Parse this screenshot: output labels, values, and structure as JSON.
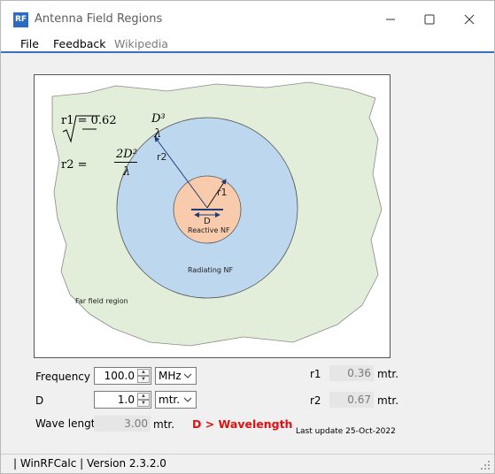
{
  "window": {
    "icon_text": "RF",
    "title": "Antenna Field Regions"
  },
  "menu": {
    "file": "File",
    "feedback": "Feedback",
    "wikipedia": "Wikipedia"
  },
  "figure": {
    "formula_r1_lhs": "r1 = 0.62",
    "formula_r1_num": "D³",
    "formula_r1_den": "λ",
    "formula_r2_lhs": "r2 =",
    "formula_r2_num": "2D²",
    "formula_r2_den": "λ",
    "label_r2": "r2",
    "label_r1": "r1",
    "label_d": "D",
    "reactive_label": "Reactive NF",
    "radiating_label": "Radiating NF",
    "farfield_label": "Far field region",
    "colors": {
      "far_field": "#e2eed9",
      "radiating": "#bdd7ee",
      "reactive": "#f8cbad",
      "arrow": "#1f3b78"
    }
  },
  "inputs": {
    "frequency_label": "Frequency",
    "frequency_value": "100.0",
    "frequency_unit": "MHz",
    "d_label": "D",
    "d_value": "1.0",
    "d_unit": "mtr.",
    "wavelength_label": "Wave length",
    "wavelength_value": "3.00",
    "wavelength_unit": "mtr."
  },
  "results": {
    "r1_label": "r1",
    "r1_value": "0.36",
    "r1_unit": "mtr.",
    "r2_label": "r2",
    "r2_value": "0.67",
    "r2_unit": "mtr."
  },
  "warning": "D > Wavelength",
  "last_update": "Last update 25-Oct-2022",
  "status": "| WinRFCalc | Version 2.3.2.0"
}
